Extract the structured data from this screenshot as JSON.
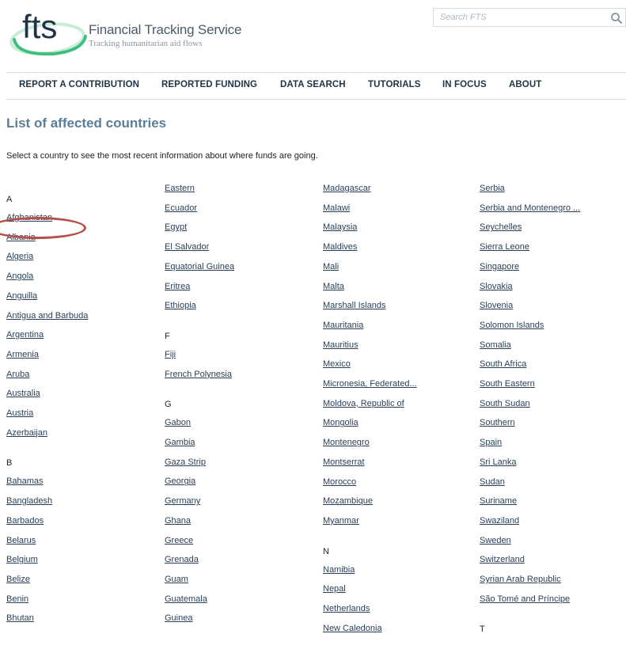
{
  "header": {
    "site_name": "Financial Tracking Service",
    "tagline": "Tracking humanitarian aid flows",
    "logo_text": "fts",
    "search_placeholder": "Search FTS"
  },
  "nav": [
    "REPORT A CONTRIBUTION",
    "REPORTED FUNDING",
    "DATA SEARCH",
    "TUTORIALS",
    "IN FOCUS",
    "ABOUT"
  ],
  "page_title": "List of affected countries",
  "intro": "Select a country to see the most recent information about where funds are going.",
  "columns": [
    [
      {
        "type": "letter",
        "text": "A"
      },
      {
        "type": "link",
        "text": "Afghanistan"
      },
      {
        "type": "link",
        "text": "Albania"
      },
      {
        "type": "link",
        "text": "Algeria"
      },
      {
        "type": "link",
        "text": "Angola"
      },
      {
        "type": "link",
        "text": "Anguilla"
      },
      {
        "type": "link",
        "text": "Antigua and Barbuda"
      },
      {
        "type": "link",
        "text": "Argentina"
      },
      {
        "type": "link",
        "text": "Armenia"
      },
      {
        "type": "link",
        "text": "Aruba"
      },
      {
        "type": "link",
        "text": "Australia"
      },
      {
        "type": "link",
        "text": "Austria"
      },
      {
        "type": "link",
        "text": "Azerbaijan"
      },
      {
        "type": "letter",
        "text": "B"
      },
      {
        "type": "link",
        "text": "Bahamas"
      },
      {
        "type": "link",
        "text": "Bangladesh"
      },
      {
        "type": "link",
        "text": "Barbados"
      },
      {
        "type": "link",
        "text": "Belarus"
      },
      {
        "type": "link",
        "text": "Belgium"
      },
      {
        "type": "link",
        "text": "Belize"
      },
      {
        "type": "link",
        "text": "Benin"
      },
      {
        "type": "link",
        "text": "Bhutan"
      }
    ],
    [
      {
        "type": "link",
        "text": "Eastern"
      },
      {
        "type": "link",
        "text": "Ecuador"
      },
      {
        "type": "link",
        "text": "Egypt"
      },
      {
        "type": "link",
        "text": "El Salvador"
      },
      {
        "type": "link",
        "text": "Equatorial Guinea"
      },
      {
        "type": "link",
        "text": "Eritrea"
      },
      {
        "type": "link",
        "text": "Ethiopia"
      },
      {
        "type": "letter",
        "text": "F"
      },
      {
        "type": "link",
        "text": "Fiji"
      },
      {
        "type": "link",
        "text": "French Polynesia"
      },
      {
        "type": "letter",
        "text": "G"
      },
      {
        "type": "link",
        "text": "Gabon"
      },
      {
        "type": "link",
        "text": "Gambia"
      },
      {
        "type": "link",
        "text": "Gaza Strip"
      },
      {
        "type": "link",
        "text": "Georgia"
      },
      {
        "type": "link",
        "text": "Germany"
      },
      {
        "type": "link",
        "text": "Ghana"
      },
      {
        "type": "link",
        "text": "Greece"
      },
      {
        "type": "link",
        "text": "Grenada"
      },
      {
        "type": "link",
        "text": "Guam"
      },
      {
        "type": "link",
        "text": "Guatemala"
      },
      {
        "type": "link",
        "text": "Guinea"
      }
    ],
    [
      {
        "type": "link",
        "text": "Madagascar"
      },
      {
        "type": "link",
        "text": "Malawi"
      },
      {
        "type": "link",
        "text": "Malaysia"
      },
      {
        "type": "link",
        "text": "Maldives"
      },
      {
        "type": "link",
        "text": "Mali"
      },
      {
        "type": "link",
        "text": "Malta"
      },
      {
        "type": "link",
        "text": "Marshall Islands"
      },
      {
        "type": "link",
        "text": "Mauritania"
      },
      {
        "type": "link",
        "text": "Mauritius"
      },
      {
        "type": "link",
        "text": "Mexico"
      },
      {
        "type": "link",
        "text": "Micronesia, Federated..."
      },
      {
        "type": "link",
        "text": "Moldova, Republic of"
      },
      {
        "type": "link",
        "text": "Mongolia"
      },
      {
        "type": "link",
        "text": "Montenegro"
      },
      {
        "type": "link",
        "text": "Montserrat"
      },
      {
        "type": "link",
        "text": "Morocco"
      },
      {
        "type": "link",
        "text": "Mozambique"
      },
      {
        "type": "link",
        "text": "Myanmar"
      },
      {
        "type": "letter",
        "text": "N"
      },
      {
        "type": "link",
        "text": "Namibia"
      },
      {
        "type": "link",
        "text": "Nepal"
      },
      {
        "type": "link",
        "text": "Netherlands"
      },
      {
        "type": "link",
        "text": "New Caledonia"
      }
    ],
    [
      {
        "type": "link",
        "text": "Serbia"
      },
      {
        "type": "link",
        "text": "Serbia and Montenegro ..."
      },
      {
        "type": "link",
        "text": "Seychelles"
      },
      {
        "type": "link",
        "text": "Sierra Leone"
      },
      {
        "type": "link",
        "text": "Singapore"
      },
      {
        "type": "link",
        "text": "Slovakia"
      },
      {
        "type": "link",
        "text": "Slovenia"
      },
      {
        "type": "link",
        "text": "Solomon Islands"
      },
      {
        "type": "link",
        "text": "Somalia"
      },
      {
        "type": "link",
        "text": "South Africa"
      },
      {
        "type": "link",
        "text": "South Eastern"
      },
      {
        "type": "link",
        "text": "South Sudan"
      },
      {
        "type": "link",
        "text": "Southern"
      },
      {
        "type": "link",
        "text": "Spain"
      },
      {
        "type": "link",
        "text": "Sri Lanka"
      },
      {
        "type": "link",
        "text": "Sudan"
      },
      {
        "type": "link",
        "text": "Suriname"
      },
      {
        "type": "link",
        "text": "Swaziland"
      },
      {
        "type": "link",
        "text": "Sweden"
      },
      {
        "type": "link",
        "text": "Switzerland"
      },
      {
        "type": "link",
        "text": "Syrian Arab Republic"
      },
      {
        "type": "link",
        "text": "São Tomé and Príncipe"
      },
      {
        "type": "letter",
        "text": "T"
      }
    ]
  ],
  "colors": {
    "title": "#5b7d98",
    "nav_text": "#1f3347",
    "link": "#2a3f57",
    "highlight_ring": "#b5504c",
    "logo_blue": "#1f3347",
    "logo_green": "#3fbf7f"
  }
}
